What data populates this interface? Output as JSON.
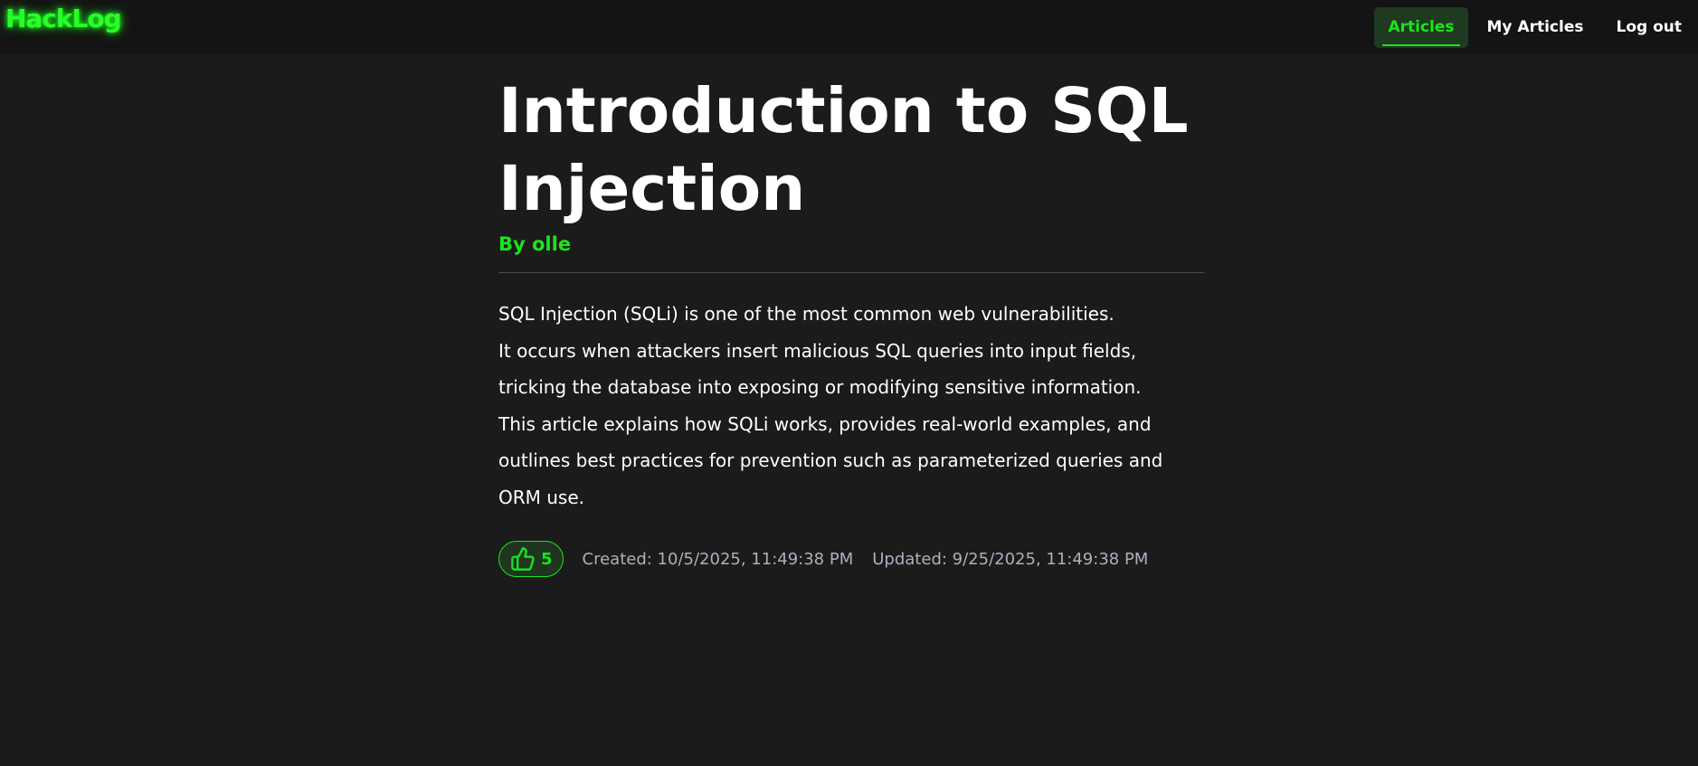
{
  "header": {
    "logo": "HackLog",
    "nav": {
      "articles": "Articles",
      "my_articles": "My Articles",
      "logout": "Log out"
    }
  },
  "article": {
    "title_line1": "Introduction to SQL",
    "title_line2": "Injection",
    "author": "By olle",
    "body": [
      "SQL Injection (SQLi) is one of the most common web vulnerabilities.",
      "It occurs when attackers insert malicious SQL queries into input fields,",
      "tricking the database into exposing or modifying sensitive information.",
      "This article explains how SQLi works, provides real-world examples, and",
      "outlines best practices for prevention such as parameterized queries and",
      "ORM use."
    ],
    "likes": "5",
    "like_icon": "thumbs-up-icon",
    "created": "Created: 10/5/2025, 11:49:38 PM",
    "updated": "Updated: 9/25/2025, 11:49:38 PM"
  },
  "colors": {
    "background": "#1b1b1b",
    "header_bg": "#141414",
    "accent_green": "#1ae51a",
    "muted_text": "#aab0bf"
  }
}
